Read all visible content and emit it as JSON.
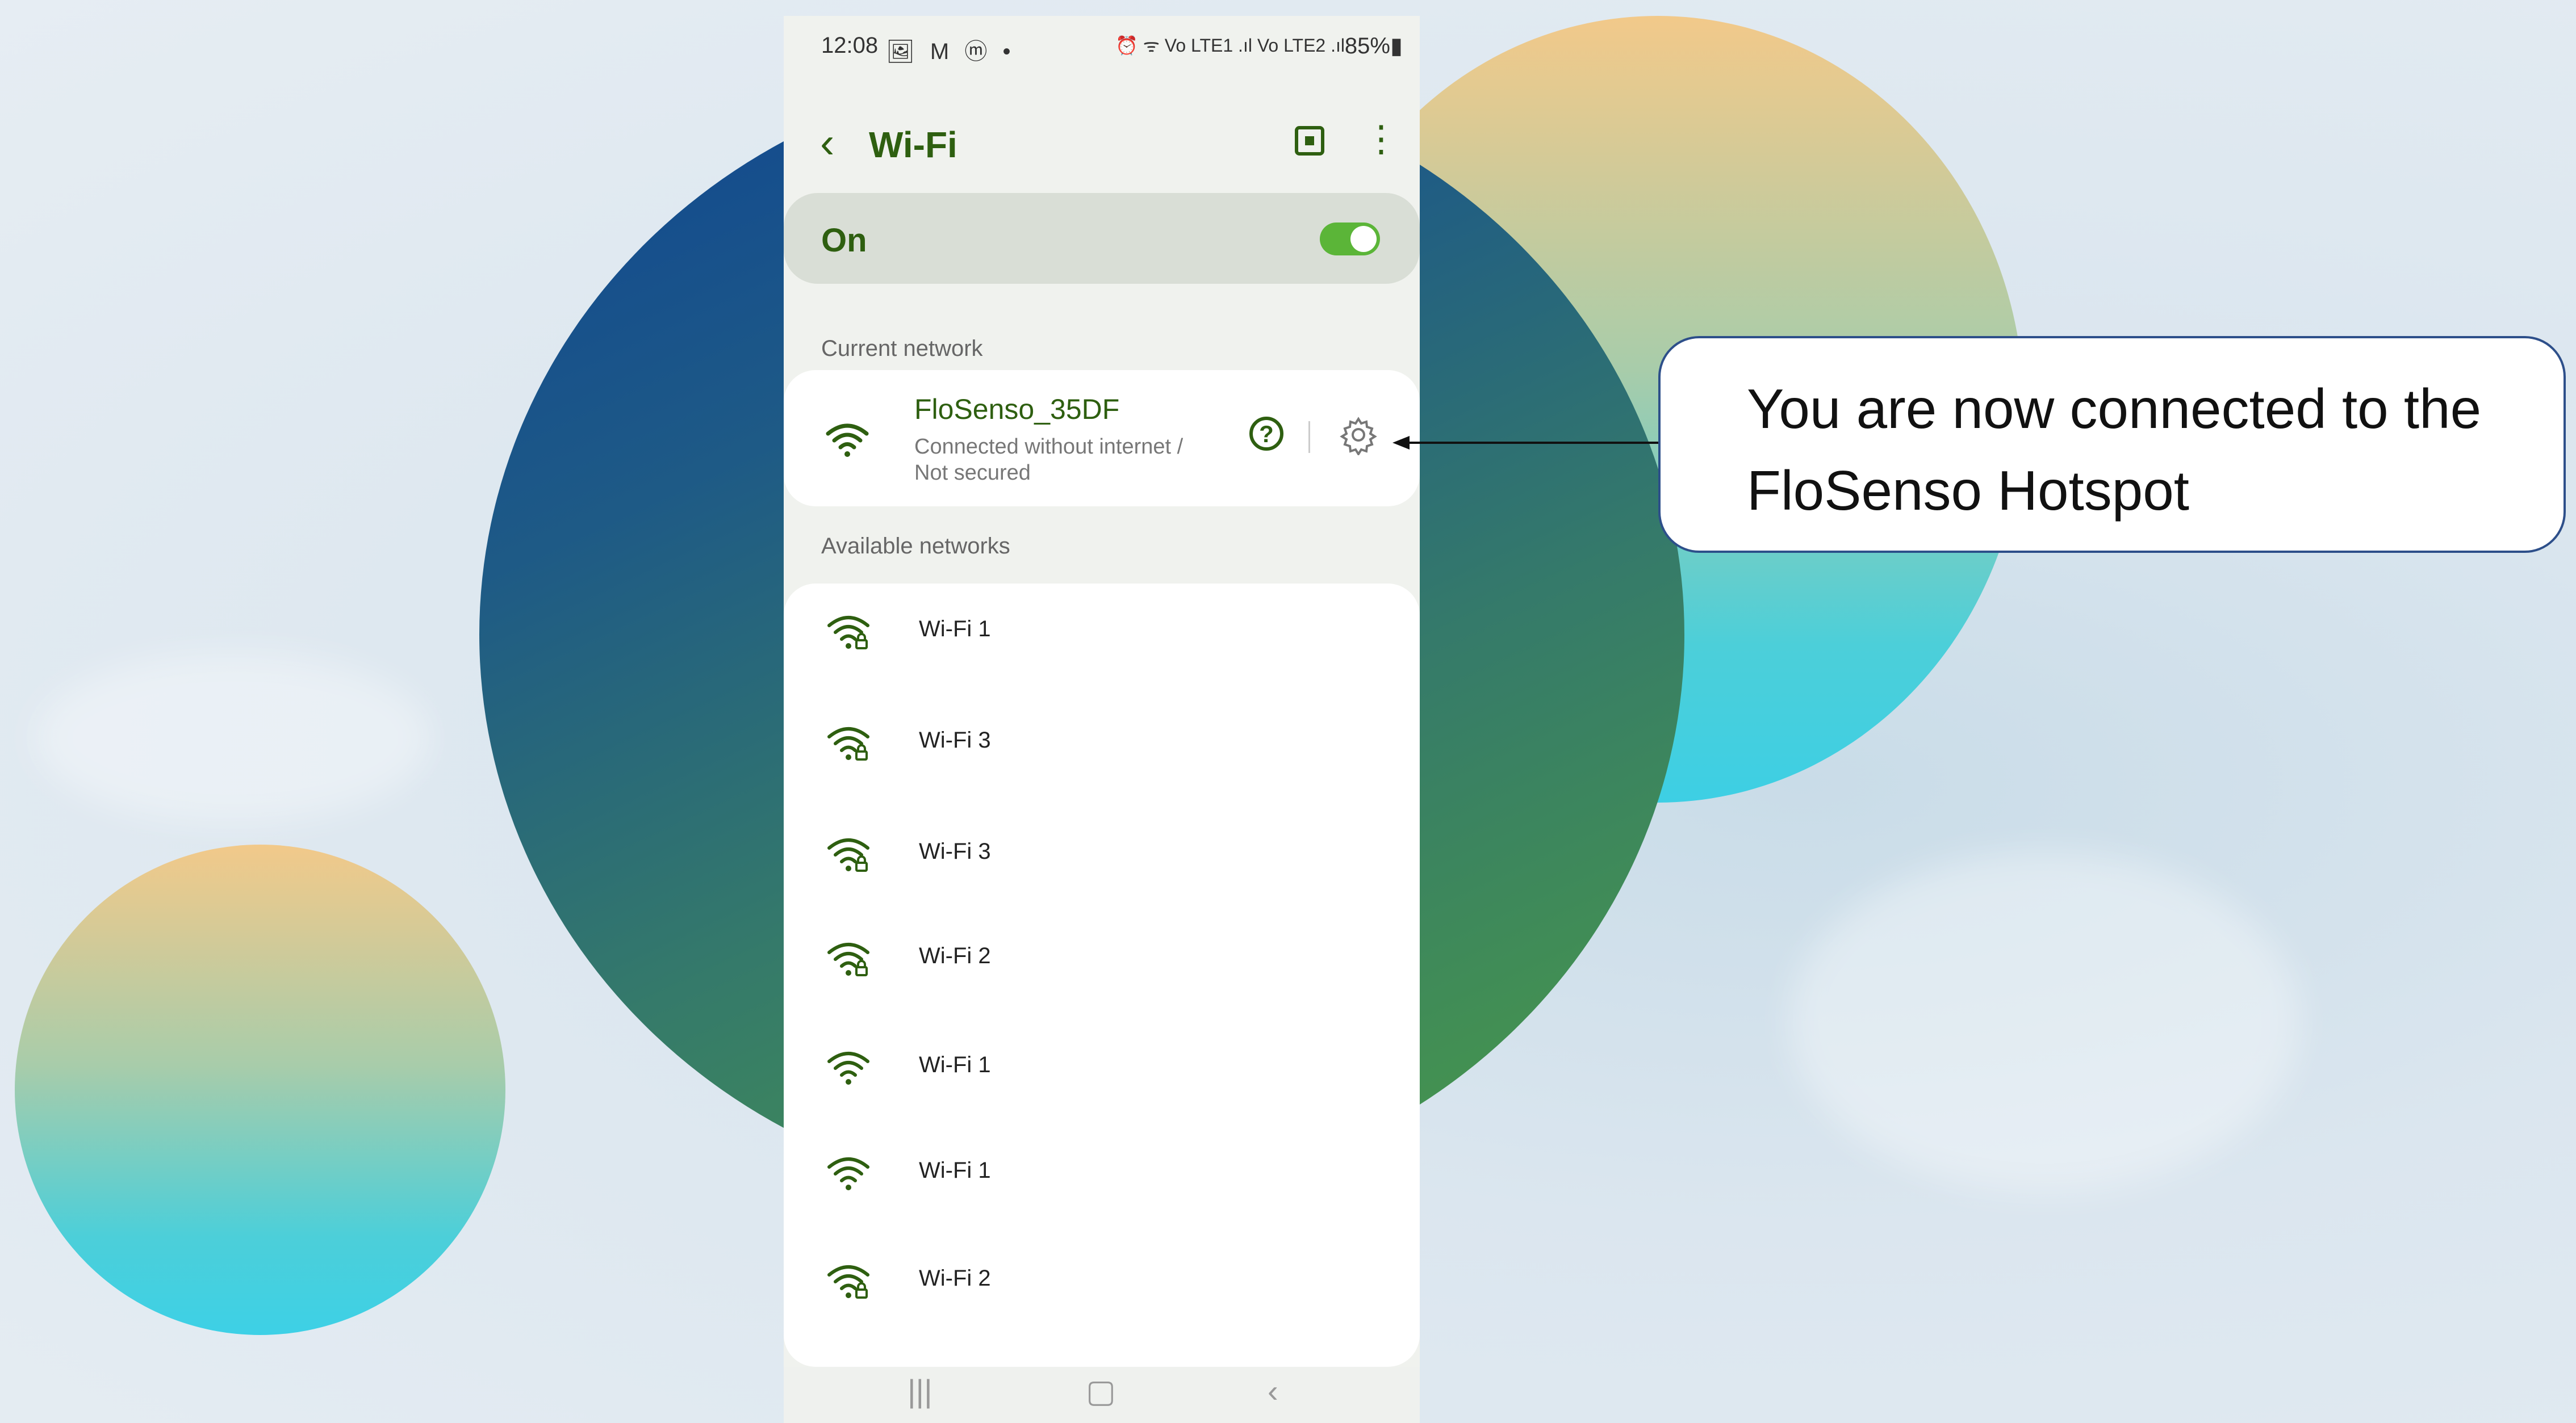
{
  "status_bar": {
    "time": "12:08",
    "left_icons": "🖼 M ⓜ •",
    "right_icons": "⏰ ᯤ Vo LTE1 .ıl Vo LTE2 .ıl",
    "battery": "85%▮"
  },
  "header": {
    "title": "Wi-Fi",
    "back": "‹",
    "more": "⋮"
  },
  "wifi_toggle": {
    "label": "On",
    "state": "on"
  },
  "current_network": {
    "section_label": "Current network",
    "name": "FloSenso_35DF",
    "status_line1": "Connected without internet /",
    "status_line2": "Not secured",
    "help": "?"
  },
  "available_networks": {
    "section_label": "Available networks",
    "items": [
      {
        "name": "Wi-Fi 1",
        "locked": true,
        "icon": "wifi-lock-icon"
      },
      {
        "name": "Wi-Fi 3",
        "locked": true,
        "icon": "wifi-lock-icon"
      },
      {
        "name": "Wi-Fi 3",
        "locked": true,
        "icon": "wifi-lock-icon"
      },
      {
        "name": "Wi-Fi 2",
        "locked": true,
        "icon": "wifi-lock-icon"
      },
      {
        "name": "Wi-Fi 1",
        "locked": false,
        "icon": "wifi-icon"
      },
      {
        "name": "Wi-Fi 1",
        "locked": false,
        "icon": "wifi-icon"
      },
      {
        "name": "Wi-Fi 2",
        "locked": true,
        "icon": "wifi-lock-icon"
      }
    ]
  },
  "nav_bar": {
    "recents": "|||",
    "home": "▢",
    "back": "‹"
  },
  "callout": {
    "line1": "You are now connected to the",
    "line2": "FloSenso Hotspot"
  },
  "colors": {
    "accent_green": "#2e5f10",
    "toggle_green": "#5bb538",
    "callout_border": "#2d4f8a"
  }
}
